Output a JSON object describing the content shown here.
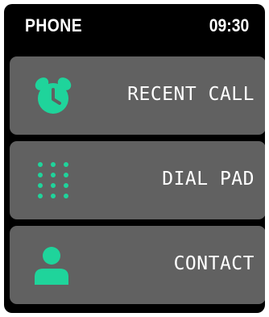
{
  "status_bar": {
    "title": "PHONE",
    "time": "09:30"
  },
  "menu": {
    "items": [
      {
        "label": "RECENT CALL",
        "icon": "alarm-clock-icon"
      },
      {
        "label": "DIAL PAD",
        "icon": "keypad-icon"
      },
      {
        "label": "CONTACT",
        "icon": "person-icon"
      }
    ]
  },
  "colors": {
    "screen_background": "#000000",
    "tile_background": "#616161",
    "accent": "#1fd49b",
    "text": "#ffffff"
  }
}
